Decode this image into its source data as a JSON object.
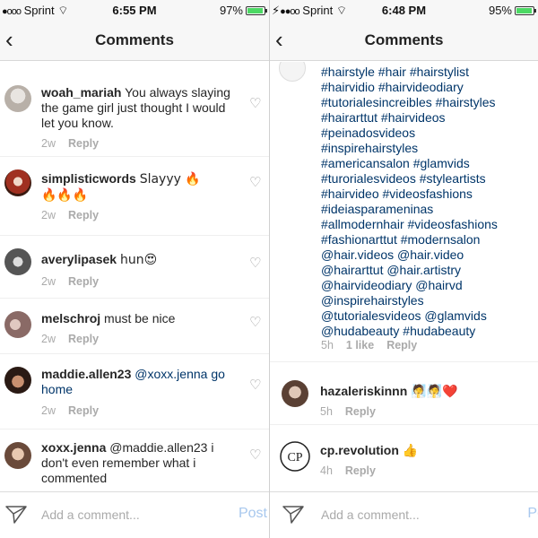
{
  "left": {
    "status": {
      "carrier": "Sprint",
      "time": "6:55 PM",
      "battery": "97%",
      "battery_level": 0.97
    },
    "nav": {
      "title": "Comments",
      "back": "‹"
    },
    "comments": [
      {
        "user": "woah_mariah",
        "text": "You always slaying the game girl just thought I would let you know.",
        "time": "2w",
        "reply": "Reply"
      },
      {
        "user": "simplisticwords",
        "text": "Slayyy 🔥",
        "text2": "🔥🔥🔥",
        "time": "2w",
        "reply": "Reply"
      },
      {
        "user": "averylipasek",
        "text": "hun😍",
        "time": "2w",
        "reply": "Reply"
      },
      {
        "user": "melschroj",
        "text": "must be nice",
        "time": "2w",
        "reply": "Reply"
      },
      {
        "user": "maddie.allen23",
        "text": "@xoxx.jenna go home",
        "time": "2w",
        "reply": "Reply"
      },
      {
        "user": "xoxx.jenna",
        "text": "@maddie.allen23 i don't even remember what i commented"
      }
    ],
    "input": {
      "placeholder": "Add a comment...",
      "post": "Post"
    }
  },
  "right": {
    "status": {
      "carrier": "Sprint",
      "time": "6:48 PM",
      "battery": "95%",
      "battery_level": 0.95
    },
    "nav": {
      "title": "Comments",
      "back": "‹"
    },
    "hashtags": [
      "#hairstyle #hair #hairstylist",
      "#hairvidio #hairvideodiary",
      "#tutorialesincreibles #hairstyles",
      "#hairarttut #hairvideos",
      "#peinadosvideos",
      "#inspirehairstyles",
      "#americansalon #glamvids",
      "#turorialesvideos #styleartists",
      "#hairvideo #videosfashions",
      "#ideiasparameninas",
      "#allmodernhair #videosfashions",
      "#fashionarttut #modernsalon",
      "@hair.videos @hair.video",
      "@hairarttut @hair.artistry",
      "@hairvideodiary @hairvd",
      "@inspirehairstyles",
      "@tutorialesvideos @glamvids",
      "@hudabeauty #hudabeauty"
    ],
    "caption_meta": {
      "time": "5h",
      "likes": "1 like",
      "reply": "Reply"
    },
    "comments": [
      {
        "user": "hazaleriskinnn",
        "text": "🧖🧖❤️",
        "time": "5h",
        "reply": "Reply"
      },
      {
        "user": "cp.revolution",
        "text": "👍",
        "time": "4h",
        "reply": "Reply"
      }
    ],
    "input": {
      "placeholder": "Add a comment...",
      "post": "Po"
    }
  }
}
